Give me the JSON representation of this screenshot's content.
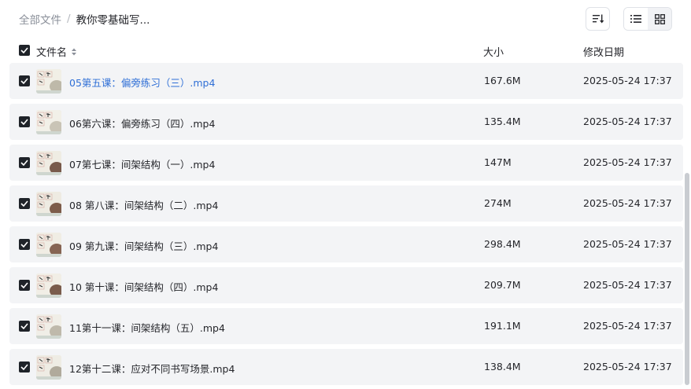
{
  "breadcrumb": {
    "root": "全部文件",
    "separator": "/",
    "current": "教你零基础写..."
  },
  "toolbar": {
    "sort_icon": "sort-icon",
    "list_view_icon": "list-view-icon",
    "grid_view_icon": "grid-view-icon"
  },
  "columns": {
    "name": "文件名",
    "size": "大小",
    "date": "修改日期"
  },
  "files": [
    {
      "name": "05第五课：偏旁练习（三）.mp4",
      "size": "167.6M",
      "date": "2025-05-24 17:37",
      "checked": true,
      "hovered": true
    },
    {
      "name": "06第六课：偏旁练习（四）.mp4",
      "size": "135.4M",
      "date": "2025-05-24 17:37",
      "checked": true
    },
    {
      "name": "07第七课：间架结构（一）.mp4",
      "size": "147M",
      "date": "2025-05-24 17:37",
      "checked": true
    },
    {
      "name": "08 第八课：间架结构（二）.mp4",
      "size": "274M",
      "date": "2025-05-24 17:37",
      "checked": true
    },
    {
      "name": "09 第九课：间架结构（三）.mp4",
      "size": "298.4M",
      "date": "2025-05-24 17:37",
      "checked": true
    },
    {
      "name": "10 第十课：间架结构（四）.mp4",
      "size": "209.7M",
      "date": "2025-05-24 17:37",
      "checked": true
    },
    {
      "name": "11第十一课：间架结构（五）.mp4",
      "size": "191.1M",
      "date": "2025-05-24 17:37",
      "checked": true
    },
    {
      "name": "12第十二课：应对不同书写场景.mp4",
      "size": "138.4M",
      "date": "2025-05-24 17:37",
      "checked": true
    }
  ],
  "colors": {
    "link": "#2f6fd6",
    "row_bg": "#f3f4f6",
    "checkbox": "#1f2329"
  }
}
